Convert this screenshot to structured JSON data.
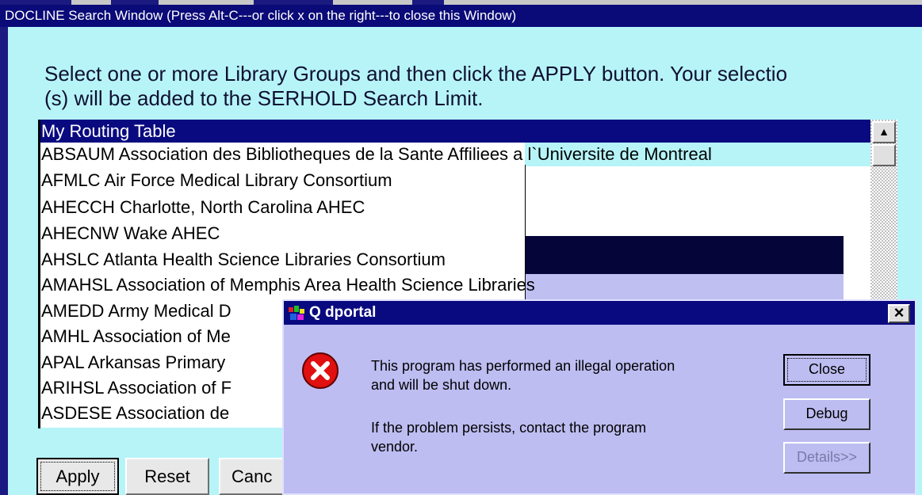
{
  "window": {
    "title": "DOCLINE Search Window   (Press Alt-C---or click x on the right---to close this Window)"
  },
  "instruction": {
    "line1": "Select one or more Library Groups and then click the APPLY button. Your selectio",
    "line2": "(s) will be added to the SERHOLD Search Limit."
  },
  "library_list": {
    "selected_item": "My Routing Table",
    "items": [
      "My Routing Table",
      "ABSAUM  Association des Bibliotheques de la Sante Affiliees a l`Universite de Montreal",
      "AFMLC  Air Force Medical Library Consortium",
      "AHECCH  Charlotte, North Carolina AHEC",
      "AHECNW  Wake AHEC",
      "AHSLC  Atlanta Health Science Libraries Consortium",
      "AMAHSL  Association of Memphis Area Health Science Libraries",
      "AMEDD  Army Medical D",
      "AMHL  Association of Me",
      "APAL  Arkansas Primary",
      "ARIHSL  Association of F",
      "ASDESE  Association de"
    ]
  },
  "buttons": {
    "apply": "Apply",
    "reset": "Reset",
    "cancel": "Canc"
  },
  "dialog": {
    "title": "Q dportal",
    "message_line1": "This program has performed an illegal operation",
    "message_line2": "and will be shut down.",
    "message_line3": "If the problem persists, contact the program",
    "message_line4": "vendor.",
    "close_label": "Close",
    "debug_label": "Debug",
    "details_label": "Details>>",
    "close_x": "×"
  },
  "colors": {
    "background": "#b6f4f8",
    "titlebar": "#0a0a78",
    "dialog_bg": "#bdbdf2",
    "error_red": "#e01010"
  }
}
